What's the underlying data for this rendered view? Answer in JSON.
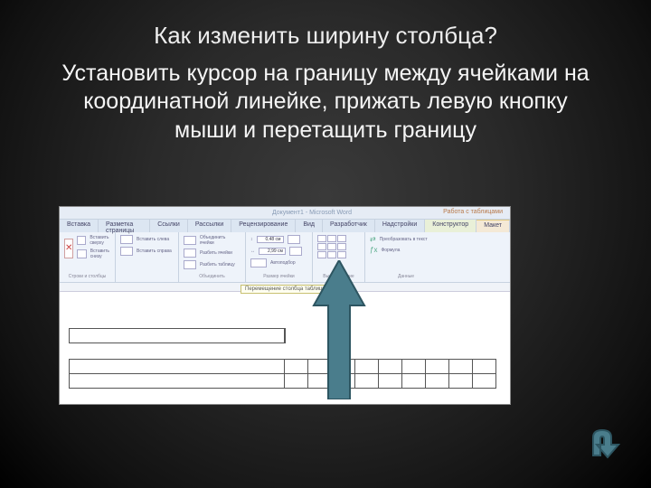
{
  "title": "Как изменить ширину столбца?",
  "body": "Установить курсор на границу между ячейками на координатной линейке, прижать левую кнопку мыши и перетащить границу",
  "word": {
    "titlebar_center": "Документ1 - Microsoft Word",
    "titlebar_right": "Работа с таблицами",
    "tabs": [
      "Вставка",
      "Разметка страницы",
      "Ссылки",
      "Рассылки",
      "Рецензирование",
      "Вид",
      "Разработчик",
      "Надстройки"
    ],
    "tab_ctx1": "Конструктор",
    "tab_ctx2": "Макет",
    "grp_delete": "Удалить",
    "grp_insert_above": "Вставить сверху",
    "grp_insert_below": "Вставить снизу",
    "grp_insert_left": "Вставить слева",
    "grp_insert_right": "Вставить справа",
    "grp_rows_label": "Строки и столбцы",
    "grp_merge": "Объединить ячейки",
    "grp_split": "Разбить ячейки",
    "grp_split_table": "Разбить таблицу",
    "grp_merge_label": "Объединить",
    "height": "0,48 см",
    "width": "2,99 см",
    "autofit": "Автоподбор",
    "grp_size_label": "Размер ячейки",
    "align_label": "Выравнивание",
    "data1": "Преобразовать в текст",
    "data2": "Формула",
    "grp_data_label": "Данные",
    "tooltip": "Перемещение столбца таблицы"
  }
}
